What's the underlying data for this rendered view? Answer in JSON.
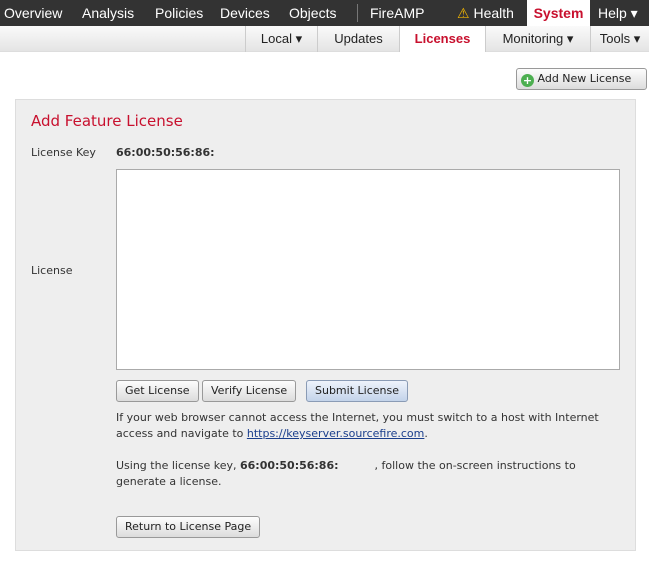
{
  "topnav": {
    "items": [
      "Overview",
      "Analysis",
      "Policies",
      "Devices",
      "Objects",
      "FireAMP"
    ],
    "health": "Health",
    "system": "System",
    "help": "Help ▾"
  },
  "subnav": {
    "local": "Local ▾",
    "updates": "Updates",
    "licenses": "Licenses",
    "monitoring": "Monitoring ▾",
    "tools": "Tools ▾"
  },
  "add_new_license": "Add New License",
  "panel": {
    "title": "Add Feature License",
    "license_key_label": "License Key",
    "license_key_value": "66:00:50:56:86:",
    "license_label": "License",
    "license_value": "",
    "buttons": {
      "get": "Get License",
      "verify": "Verify License",
      "submit": "Submit License",
      "return": "Return to License Page"
    },
    "info1_a": "If your web browser cannot access the Internet, you must switch to a host with Internet access and navigate to ",
    "info1_link": "https://keyserver.sourcefire.com",
    "info1_b": ".",
    "info2_a": "Using the license key, ",
    "info2_key": "66:00:50:56:86:",
    "info2_b": ", follow the on-screen instructions to generate a license."
  },
  "colors": {
    "accent": "#c8102e",
    "nav_bg": "#333333",
    "panel_bg": "#eeeeee"
  }
}
